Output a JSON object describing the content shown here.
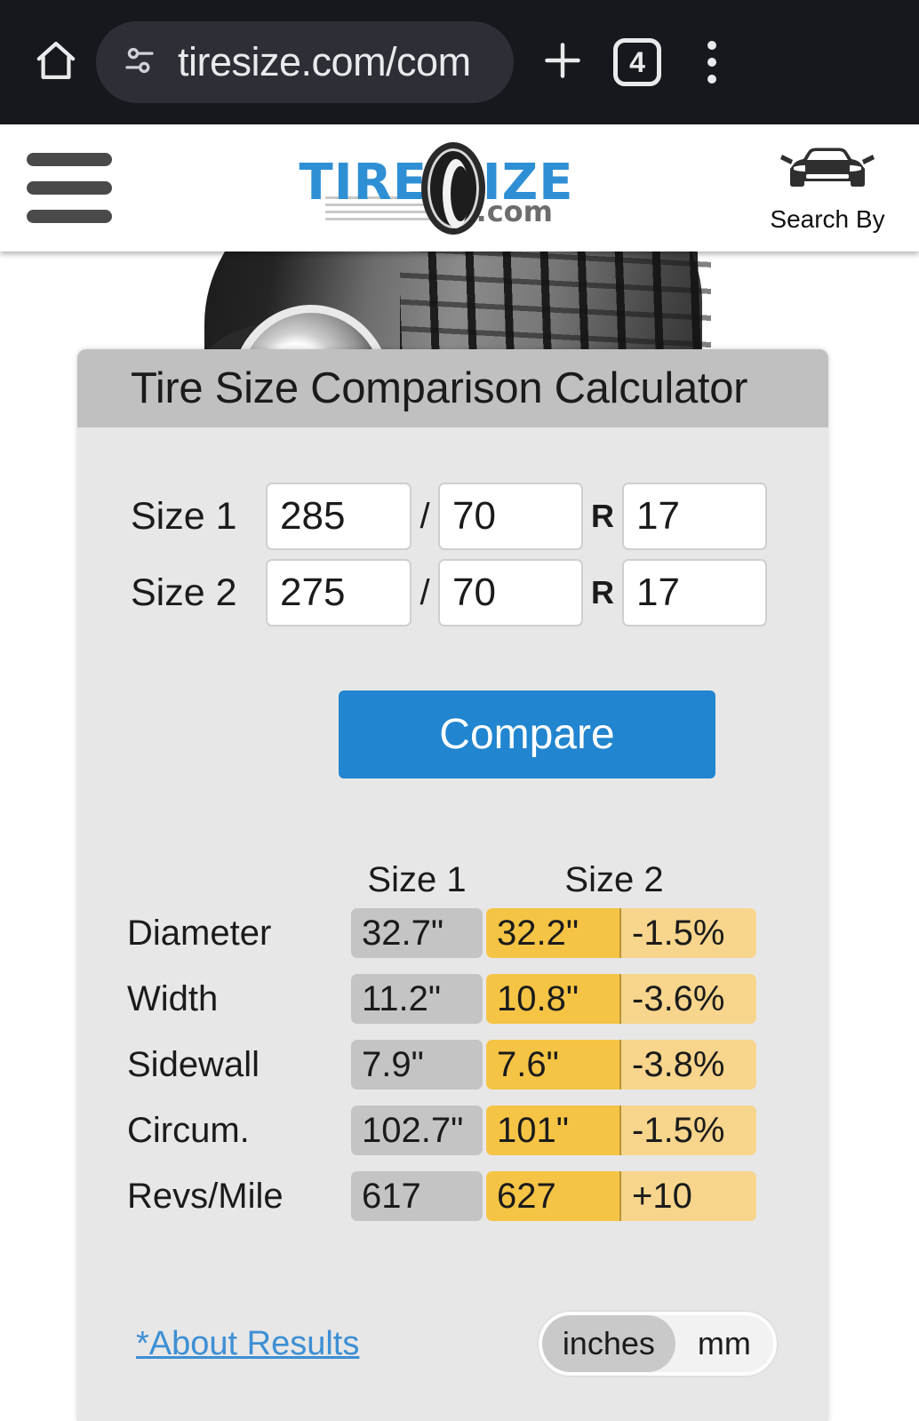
{
  "browser": {
    "url": "tiresize.com/com",
    "tab_count": "4",
    "icons": {
      "home": "home-icon",
      "site_settings": "tune-icon",
      "new_tab": "plus-icon",
      "tabs": "tab-counter-icon",
      "menu": "more-vertical-icon"
    }
  },
  "site_header": {
    "menu_icon": "hamburger-icon",
    "logo": {
      "text": "TIRE  SIZE",
      "dotcom": ".com",
      "color": "#2f8fd4",
      "dotcom_color": "#6d6d6d"
    },
    "search_by": {
      "label": "Search By",
      "icon": "car-front-icon"
    }
  },
  "calculator": {
    "title": "Tire Size Comparison Calculator",
    "title_bg": "#c0c0c0",
    "card_bg": "#e7e7e7",
    "rows": [
      {
        "label": "Size 1",
        "width": "285",
        "aspect": "70",
        "diameter": "17",
        "width_placeholder": "",
        "aspect_placeholder": "",
        "diameter_placeholder": ""
      },
      {
        "label": "Size 2",
        "width": "275",
        "aspect": "70",
        "diameter": "17",
        "width_placeholder": "",
        "aspect_placeholder": "",
        "diameter_placeholder": ""
      }
    ],
    "separator_slash": "/",
    "separator_r": "R",
    "compare_label": "Compare",
    "compare_color": "#2185d0"
  },
  "results": {
    "col_headers": [
      "",
      "Size 1",
      "Size 2"
    ],
    "header_size1": "Size 1",
    "header_size2": "Size 2",
    "size1_cell_color": "#c4c4c4",
    "size2_cell_color": "#f6c445",
    "diff_cell_color": "#f7d58c",
    "rows": [
      {
        "name": "Diameter",
        "size1": "32.7\"",
        "size2": "32.2\"",
        "diff": "-1.5%"
      },
      {
        "name": "Width",
        "size1": "11.2\"",
        "size2": "10.8\"",
        "diff": "-3.6%"
      },
      {
        "name": "Sidewall",
        "size1": "7.9\"",
        "size2": "7.6\"",
        "diff": "-3.8%"
      },
      {
        "name": "Circum.",
        "size1": "102.7\"",
        "size2": "101\"",
        "diff": "-1.5%"
      },
      {
        "name": "Revs/Mile",
        "size1": "617",
        "size2": "627",
        "diff": "+10"
      }
    ]
  },
  "footer": {
    "about_link": "*About Results",
    "about_link_color": "#3d8fd4",
    "units": {
      "selected": "inches",
      "options": [
        "inches",
        "mm"
      ],
      "option_inches": "inches",
      "option_mm": "mm"
    }
  }
}
